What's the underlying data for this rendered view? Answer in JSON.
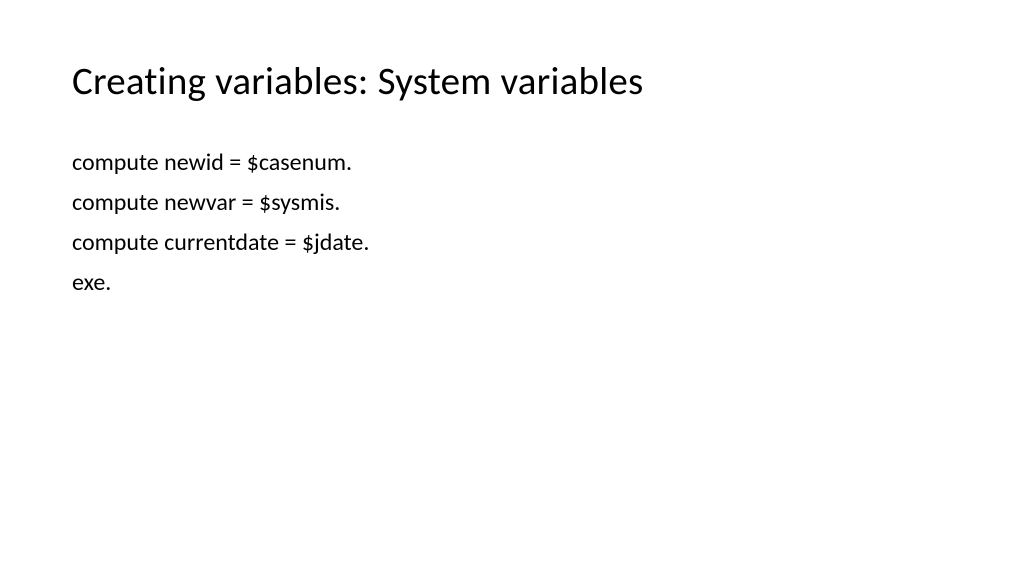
{
  "slide": {
    "title": "Creating variables: System variables",
    "lines": [
      "compute newid = $casenum.",
      "compute newvar = $sysmis.",
      "compute currentdate = $jdate.",
      "exe."
    ]
  }
}
